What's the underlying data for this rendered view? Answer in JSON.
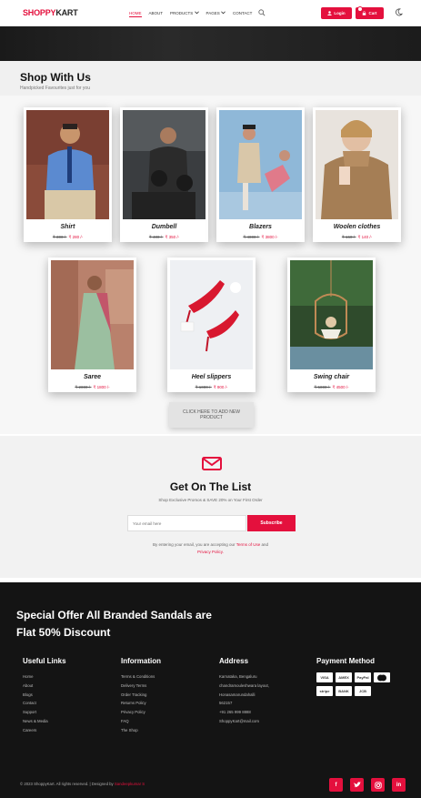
{
  "nav": {
    "logo_part1": "SHOPPY",
    "logo_part2": "KART",
    "menu": [
      "HOME",
      "ABOUT",
      "PRODUCTS",
      "PAGES",
      "CONTACT"
    ],
    "login_label": "Login",
    "cart_label": "Cart"
  },
  "shop": {
    "title": "Shop With Us",
    "subtitle": "Handpicked Favourites just for you",
    "products": [
      {
        "name": "Shirt",
        "old_price": "₹ 300 /-",
        "new_price": "₹ 280 /-"
      },
      {
        "name": "Dumbell",
        "old_price": "₹ 400 /-",
        "new_price": "₹ 350 /-"
      },
      {
        "name": "Blazers",
        "old_price": "₹ 4000 /-",
        "new_price": "₹ 3800 /-"
      },
      {
        "name": "Woolen clothes",
        "old_price": "₹ 160 /-",
        "new_price": "₹ 140 /-"
      },
      {
        "name": "Saree",
        "old_price": "₹ 2000 /-",
        "new_price": "₹ 1800 /-"
      },
      {
        "name": "Heel slippers",
        "old_price": "₹ 1000 /-",
        "new_price": "₹ 900 /-"
      },
      {
        "name": "Swing chair",
        "old_price": "₹ 5000 /-",
        "new_price": "₹ 4500 /-"
      }
    ],
    "add_button": "CLICK HERE TO ADD NEW PRODUCT"
  },
  "newsletter": {
    "title": "Get On The List",
    "subtitle": "Shop Exclusive Promos & SAVE 20% on Your First Order",
    "email_placeholder": "Your email here",
    "subscribe_label": "Subscribe",
    "note_prefix": "By entering your email, you are accepting our",
    "terms_link": "Terms of Use",
    "note_and": "and",
    "privacy_link": "Privacy Policy."
  },
  "footer": {
    "offer_line1": "Special Offer All Branded Sandals are",
    "offer_line2": "Flat 50% Discount",
    "useful_links": {
      "title": "Useful Links",
      "items": [
        "Home",
        "About",
        "Blogs",
        "Contact",
        "Support",
        "News & Media",
        "Careers"
      ]
    },
    "information": {
      "title": "Information",
      "items": [
        "Terms & Conditions",
        "Delivery Terms",
        "Order Tracking",
        "Returns Policy",
        "Privacy Policy",
        "FAQ",
        "The Shop"
      ]
    },
    "address": {
      "title": "Address",
      "items": [
        "Karnataka, Bengaluru",
        "chandramouleshwara layout,",
        "Honasamarundahalli",
        "562157",
        "+91 265 999 8888",
        "ShoppyKart@mail.com"
      ]
    },
    "payment": {
      "title": "Payment Method",
      "row1": [
        "VISA",
        "AMEX",
        "PayPal",
        "MC"
      ],
      "row2": [
        "stripe",
        "BANK",
        "JCB"
      ]
    },
    "copyright": "© 2023 ShoppyKart. All rights reserved. | Designed by",
    "designer": "Sandeepkumar S",
    "social": [
      "f",
      "t",
      "ig",
      "in"
    ]
  },
  "colors": {
    "accent": "#e4103d",
    "footer_bg": "#141414"
  }
}
